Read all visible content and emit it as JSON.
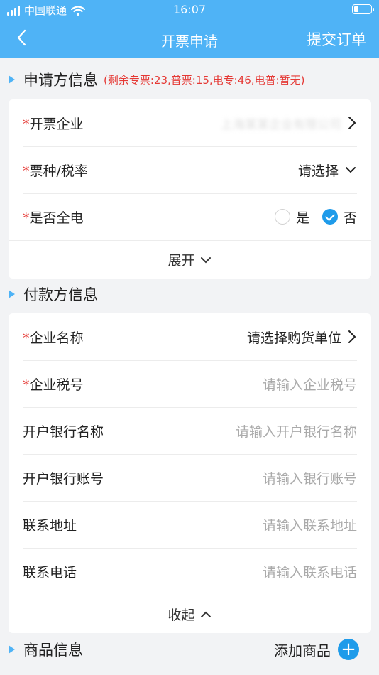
{
  "status": {
    "carrier": "中国联通",
    "time": "16:07",
    "battery_level": 0.3
  },
  "nav": {
    "title": "开票申请",
    "submit_label": "提交订单"
  },
  "applicant": {
    "title": "申请方信息",
    "quota": "(剩余专票:23,普票:15,电专:46,电普:暂无)",
    "rows": [
      {
        "label": "开票企业",
        "value": "上海某某企业有限公司"
      },
      {
        "label": "票种/税率",
        "value": "请选择"
      },
      {
        "label": "是否全电",
        "opt_yes": "是",
        "opt_no": "否",
        "selected": "否"
      }
    ],
    "expand_label": "展开"
  },
  "payer": {
    "title": "付款方信息",
    "rows": [
      {
        "label": "企业名称",
        "value": "请选择购货单位"
      },
      {
        "label": "企业税号",
        "placeholder": "请输入企业税号"
      },
      {
        "label": "开户银行名称",
        "placeholder": "请输入开户银行名称"
      },
      {
        "label": "开户银行账号",
        "placeholder": "请输入银行账号"
      },
      {
        "label": "联系地址",
        "placeholder": "请输入联系地址"
      },
      {
        "label": "联系电话",
        "placeholder": "请输入联系电话"
      }
    ],
    "collapse_label": "收起"
  },
  "goods": {
    "title": "商品信息",
    "add_label": "添加商品"
  },
  "required_mark": "*"
}
